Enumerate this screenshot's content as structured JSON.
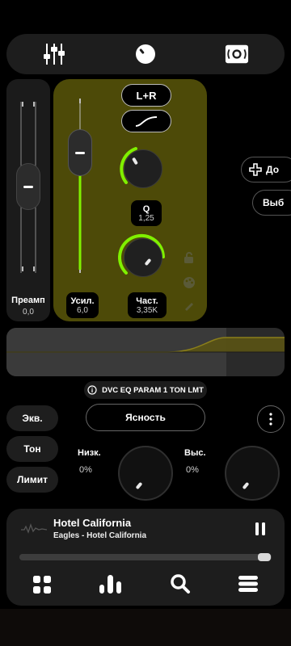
{
  "top_tabs": [
    {
      "name": "equalizer",
      "icon": "sliders-icon"
    },
    {
      "name": "knob",
      "icon": "knob-icon"
    },
    {
      "name": "speaker",
      "icon": "speaker-icon"
    }
  ],
  "eq": {
    "channel_button": "L+R",
    "curve_icon": "curve-icon",
    "preamp": {
      "label": "Преамп",
      "value": "0,0"
    },
    "gain": {
      "label": "Усил.",
      "value": "6,0"
    },
    "q": {
      "label": "Q",
      "value": "1,25"
    },
    "freq": {
      "label": "Част.",
      "value": "3,35K"
    },
    "accent_color": "#7ff000",
    "panel_color": "#4d4a08"
  },
  "side_buttons": {
    "add": "До",
    "select": "Выб"
  },
  "preset_info": "DVC EQ PARAM 1 TON LMT",
  "mode_buttons": [
    "Экв.",
    "Тон",
    "Лимит"
  ],
  "clarity_button": "Ясность",
  "tone": {
    "low": {
      "label": "Низк.",
      "value": "0%"
    },
    "high": {
      "label": "Выс.",
      "value": "0%"
    }
  },
  "player": {
    "title": "Hotel California",
    "subtitle": "Eagles - Hotel California",
    "progress": 0.97
  },
  "bottom_nav": [
    {
      "name": "library",
      "icon": "grid-icon"
    },
    {
      "name": "visualizer",
      "icon": "bars-icon"
    },
    {
      "name": "search",
      "icon": "search-icon"
    },
    {
      "name": "menu",
      "icon": "menu-icon"
    }
  ]
}
